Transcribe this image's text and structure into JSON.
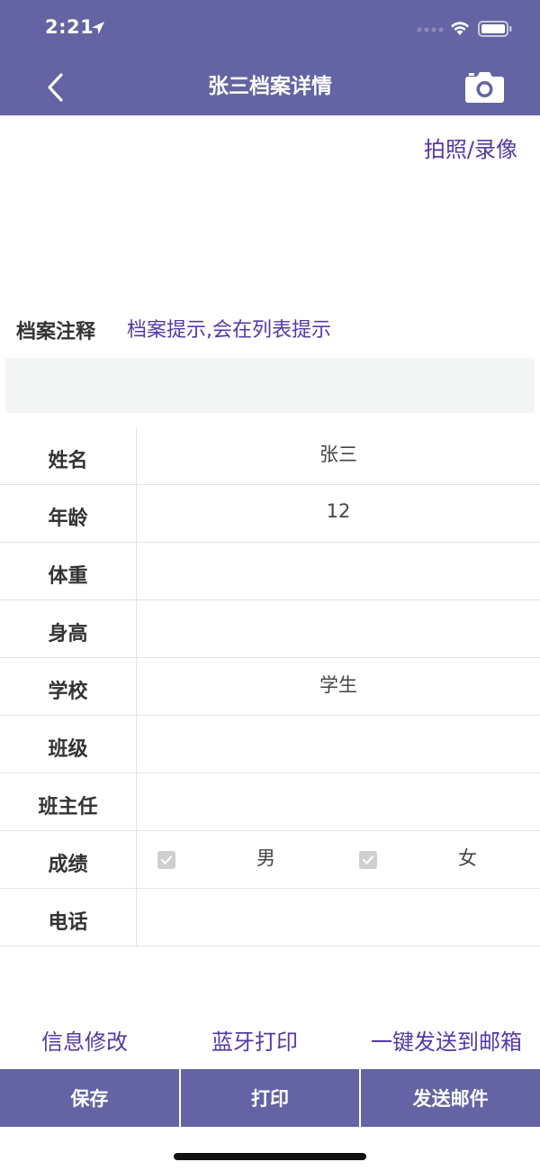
{
  "status": {
    "time": "2:21"
  },
  "nav": {
    "title": "张三档案详情",
    "back_icon": "chevron-left-icon",
    "camera_icon": "camera-icon"
  },
  "photo_link": "拍照/录像",
  "note": {
    "label": "档案注释",
    "value": "档案提示,会在列表提示"
  },
  "profile": {
    "rows": [
      {
        "label": "姓名",
        "value": "张三"
      },
      {
        "label": "年龄",
        "value": "12"
      },
      {
        "label": "体重",
        "value": ""
      },
      {
        "label": "身高",
        "value": ""
      },
      {
        "label": "学校",
        "value": "学生"
      },
      {
        "label": "班级",
        "value": ""
      },
      {
        "label": "班主任",
        "value": ""
      },
      {
        "label": "成绩",
        "value": ""
      },
      {
        "label": "电话",
        "value": ""
      }
    ],
    "gender": {
      "male": "男",
      "female": "女"
    }
  },
  "actions": {
    "edit": "信息修改",
    "bluetooth_print": "蓝牙打印",
    "send_email_one_click": "一键发送到邮箱"
  },
  "bottom_bar": {
    "save": "保存",
    "print": "打印",
    "send_email": "发送邮件"
  },
  "colors": {
    "brand": "#6464a4",
    "link": "#5538a6"
  }
}
